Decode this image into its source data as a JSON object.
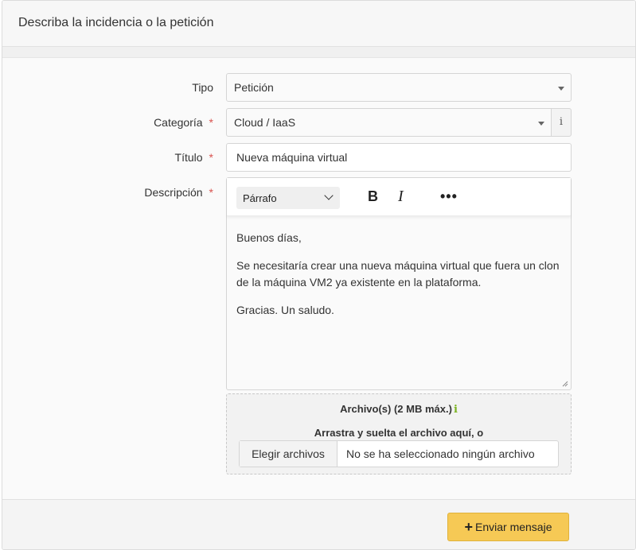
{
  "header": {
    "title": "Describa la incidencia o la petición"
  },
  "form": {
    "tipo": {
      "label": "Tipo",
      "value": "Petición"
    },
    "categoria": {
      "label": "Categoría",
      "required_mark": "*",
      "value": "Cloud / IaaS",
      "info_glyph": "i"
    },
    "titulo": {
      "label": "Título",
      "required_mark": "*",
      "value": "Nueva máquina virtual"
    },
    "descripcion": {
      "label": "Descripción",
      "required_mark": "*",
      "toolbar": {
        "format": "Párrafo",
        "bold": "B",
        "italic": "I",
        "more": "•••"
      },
      "paragraphs": [
        "Buenos días,",
        "Se necesitaría crear una nueva máquina virtual que fuera un clon de la máquina VM2 ya existente en la plataforma.",
        "Gracias. Un saludo."
      ]
    },
    "attachments": {
      "title": "Archivo(s) (2 MB máx.)",
      "info_glyph": "i",
      "drop_text": "Arrastra y suelta el archivo aquí, o",
      "choose_button": "Elegir archivos",
      "no_file_text": "No se ha seleccionado ningún archivo"
    }
  },
  "footer": {
    "submit_label": "Enviar mensaje",
    "submit_icon": "+"
  },
  "colors": {
    "accent": "#f6c955",
    "required": "#d9534f",
    "info_green": "#7bb321"
  }
}
